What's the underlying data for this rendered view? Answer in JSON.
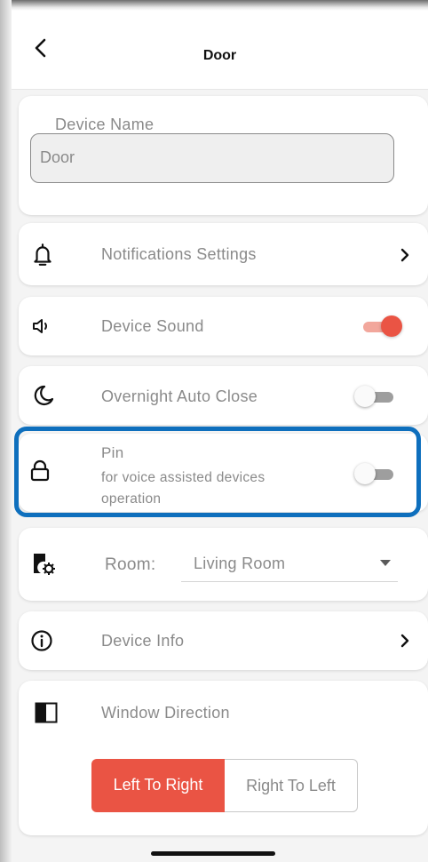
{
  "header": {
    "title": "Door"
  },
  "device_name": {
    "label": "Device Name",
    "value": "Door"
  },
  "notifications": {
    "label": "Notifications Settings"
  },
  "device_sound": {
    "label": "Device Sound",
    "enabled": true
  },
  "overnight": {
    "label": "Overnight Auto Close",
    "enabled": false
  },
  "pin": {
    "label": "Pin",
    "description": "for voice assisted devices operation",
    "enabled": false
  },
  "room": {
    "label": "Room:",
    "value": "Living Room"
  },
  "device_info": {
    "label": "Device Info"
  },
  "window_direction": {
    "label": "Window Direction",
    "options": [
      "Left To Right",
      "Right To Left"
    ],
    "selected": "Left To Right"
  },
  "colors": {
    "accent": "#EA5444",
    "accent_light": "#F2A79C",
    "highlight": "#0E6FBD",
    "text_muted": "#8A8A8A"
  }
}
